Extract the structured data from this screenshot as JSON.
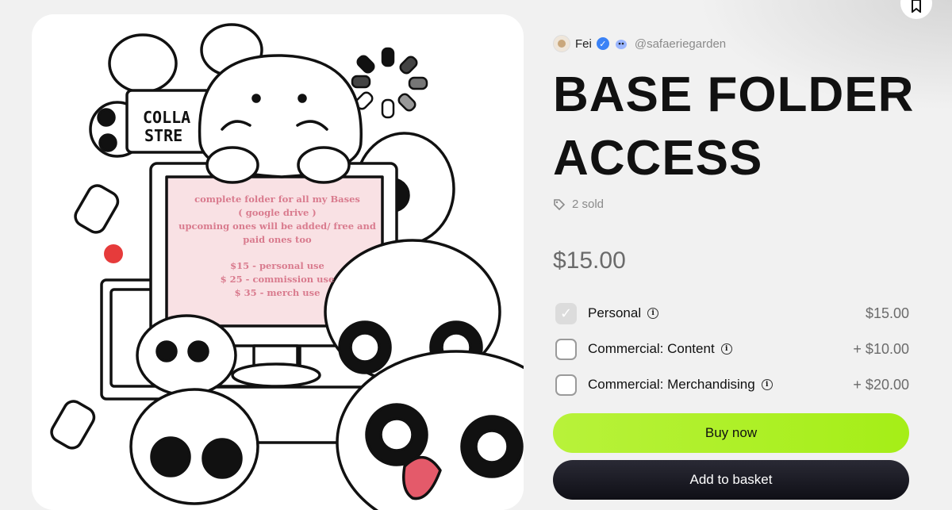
{
  "seller": {
    "name": "Fei",
    "handle": "@safaeriegarden"
  },
  "product": {
    "title_line1": "BASE FOLDER",
    "title_line2": "ACCESS",
    "sold": "2 sold",
    "price": "$15.00"
  },
  "artwork": {
    "sign_line1": "COLLA",
    "sign_line2": "STRE",
    "screen_lines": [
      "complete folder for all my Bases",
      "( google drive )",
      "upcoming ones will be added/ free and",
      "paid ones too",
      "$15 - personal use",
      "$ 25 - commission use",
      "$ 35 - merch use"
    ]
  },
  "license_options": [
    {
      "label": "Personal",
      "price": "$15.00",
      "checked": true
    },
    {
      "label": "Commercial: Content",
      "price": "+ $10.00",
      "checked": false
    },
    {
      "label": "Commercial: Merchandising",
      "price": "+ $20.00",
      "checked": false
    }
  ],
  "actions": {
    "buy_label": "Buy now",
    "basket_label": "Add to basket"
  },
  "colors": {
    "buy_button": "#a8ef1f",
    "basket_button": "#14141c",
    "verified_badge": "#3b82f6",
    "screen_text": "#d97b8e",
    "screen_bg": "#f9e1e4"
  },
  "icons": {
    "bookmark": "bookmark-icon",
    "verified": "verified-check-icon",
    "badge": "cloud-creature-icon",
    "tag": "tag-icon",
    "info": "info-icon",
    "check": "check-icon"
  }
}
